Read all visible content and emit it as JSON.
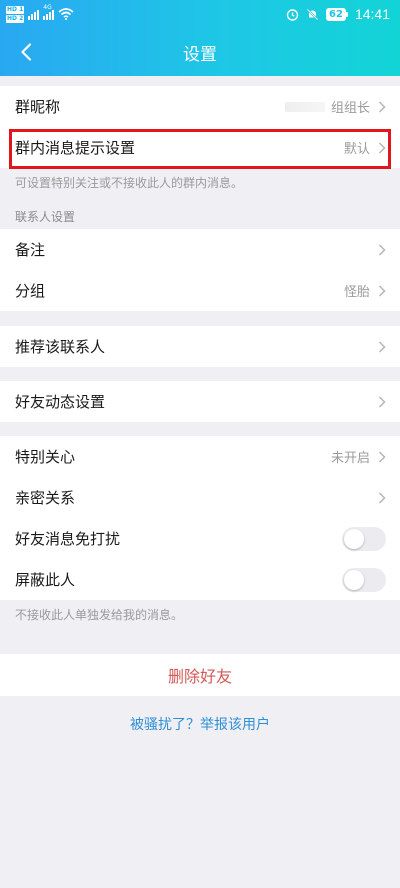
{
  "status_bar": {
    "time": "14:41",
    "battery": "62",
    "network": "4G",
    "sim_badges": [
      "HD 1",
      "HD 2"
    ]
  },
  "header": {
    "title": "设置"
  },
  "rows": {
    "nickname": {
      "label": "群昵称",
      "value": "组组长"
    },
    "group_msg": {
      "label": "群内消息提示设置",
      "value": "默认"
    },
    "remark": {
      "label": "备注"
    },
    "grouping": {
      "label": "分组",
      "value": "怪胎"
    },
    "recommend": {
      "label": "推荐该联系人"
    },
    "moments": {
      "label": "好友动态设置"
    },
    "special_care": {
      "label": "特别关心",
      "value": "未开启"
    },
    "intimate": {
      "label": "亲密关系"
    },
    "dnd": {
      "label": "好友消息免打扰",
      "enabled": false
    },
    "block": {
      "label": "屏蔽此人",
      "enabled": false
    }
  },
  "notes": {
    "group_msg_note": "可设置特别关注或不接收此人的群内消息。",
    "contact_section": "联系人设置",
    "block_note": "不接收此人单独发给我的消息。"
  },
  "actions": {
    "delete": "删除好友",
    "report": "被骚扰了？举报该用户"
  },
  "colors": {
    "header_gradient_start": "#29a8f2",
    "header_gradient_end": "#12d4d6",
    "highlight": "#e0161b",
    "delete": "#d25a57",
    "link": "#2f8fd6"
  }
}
